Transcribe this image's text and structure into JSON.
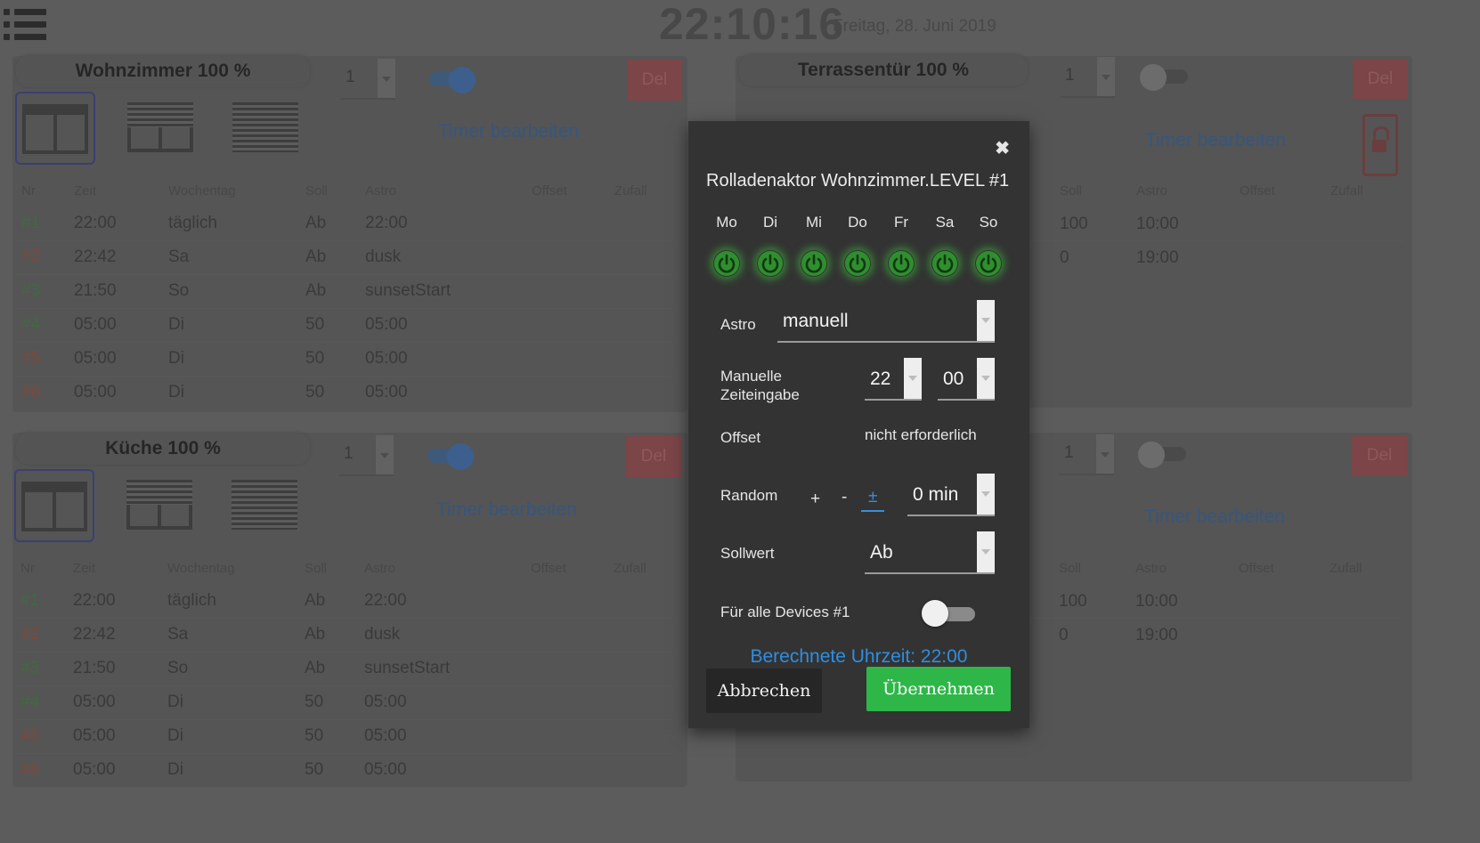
{
  "header": {
    "clock": "22:10:16",
    "date": "Freitag, 28. Juni 2019"
  },
  "panels": {
    "wohnzimmer": {
      "title": "Wohnzimmer 100 %",
      "select_value": "1",
      "toggle_on": true,
      "del_label": "Del",
      "timer_link": "Timer bearbeiten",
      "headers": [
        "Nr",
        "Zeit",
        "Wochentag",
        "Soll",
        "Astro",
        "Offset",
        "Zufall"
      ],
      "rows": [
        {
          "nr": "#1",
          "zeit": "22:00",
          "tag": "täglich",
          "soll": "Ab",
          "astro": "22:00",
          "color": "green"
        },
        {
          "nr": "#2",
          "zeit": "22:42",
          "tag": "Sa",
          "soll": "Ab",
          "astro": "dusk",
          "color": "red"
        },
        {
          "nr": "#3",
          "zeit": "21:50",
          "tag": "So",
          "soll": "Ab",
          "astro": "sunsetStart",
          "color": "green"
        },
        {
          "nr": "#4",
          "zeit": "05:00",
          "tag": "Di",
          "soll": "50",
          "astro": "05:00",
          "color": "green"
        },
        {
          "nr": "#5",
          "zeit": "05:00",
          "tag": "Di",
          "soll": "50",
          "astro": "05:00",
          "color": "red"
        },
        {
          "nr": "#6",
          "zeit": "05:00",
          "tag": "Di",
          "soll": "50",
          "astro": "05:00",
          "color": "red"
        }
      ]
    },
    "kueche": {
      "title": "Küche 100 %",
      "select_value": "1",
      "toggle_on": true,
      "del_label": "Del",
      "timer_link": "Timer bearbeiten",
      "headers": [
        "Nr",
        "Zeit",
        "Wochentag",
        "Soll",
        "Astro",
        "Offset",
        "Zufall"
      ],
      "rows": [
        {
          "nr": "#1",
          "zeit": "22:00",
          "tag": "täglich",
          "soll": "Ab",
          "astro": "22:00",
          "color": "green"
        },
        {
          "nr": "#2",
          "zeit": "22:42",
          "tag": "Sa",
          "soll": "Ab",
          "astro": "dusk",
          "color": "red"
        },
        {
          "nr": "#3",
          "zeit": "21:50",
          "tag": "So",
          "soll": "Ab",
          "astro": "sunsetStart",
          "color": "green"
        },
        {
          "nr": "#4",
          "zeit": "05:00",
          "tag": "Di",
          "soll": "50",
          "astro": "05:00",
          "color": "green"
        },
        {
          "nr": "#5",
          "zeit": "05:00",
          "tag": "Di",
          "soll": "50",
          "astro": "05:00",
          "color": "red"
        },
        {
          "nr": "#6",
          "zeit": "05:00",
          "tag": "Di",
          "soll": "50",
          "astro": "05:00",
          "color": "red"
        }
      ]
    },
    "terrassentuer": {
      "title": "Terrassentür 100 %",
      "select_value": "1",
      "toggle_on": false,
      "del_label": "Del",
      "timer_link": "Timer bearbeiten",
      "headers": [
        "Soll",
        "Astro",
        "Offset",
        "Zufall"
      ],
      "rows": [
        {
          "soll": "100",
          "astro": "10:00"
        },
        {
          "soll": "0",
          "astro": "19:00"
        }
      ]
    },
    "fourth": {
      "select_value": "1",
      "toggle_on": false,
      "del_label": "Del",
      "timer_link": "Timer bearbeiten",
      "headers": [
        "Soll",
        "Astro",
        "Offset",
        "Zufall"
      ],
      "rows": [
        {
          "soll": "100",
          "astro": "10:00"
        },
        {
          "soll": "0",
          "astro": "19:00"
        }
      ]
    }
  },
  "modal": {
    "close": "✖",
    "title": "Rolladenaktor Wohnzimmer.LEVEL #1",
    "days": [
      "Mo",
      "Di",
      "Mi",
      "Do",
      "Fr",
      "Sa",
      "So"
    ],
    "astro_label": "Astro",
    "astro_value": "manuell",
    "manual_label_1": "Manuelle",
    "manual_label_2": "Zeiteingabe",
    "hour": "22",
    "minute": "00",
    "offset_label": "Offset",
    "offset_value": "nicht erforderlich",
    "random_label": "Random",
    "random_plus": "+",
    "random_minus": "-",
    "random_pm": "±",
    "random_value": "0 min",
    "sollwert_label": "Sollwert",
    "sollwert_value": "Ab",
    "all_devices_label": "Für alle Devices #1",
    "calculated": "Berechnete Uhrzeit: 22:00",
    "cancel": "Abbrechen",
    "apply": "Übernehmen"
  },
  "colors": {
    "accent_blue": "#2f8ee0",
    "apply_green": "#2fb649",
    "power_green": "#3cc83c"
  }
}
